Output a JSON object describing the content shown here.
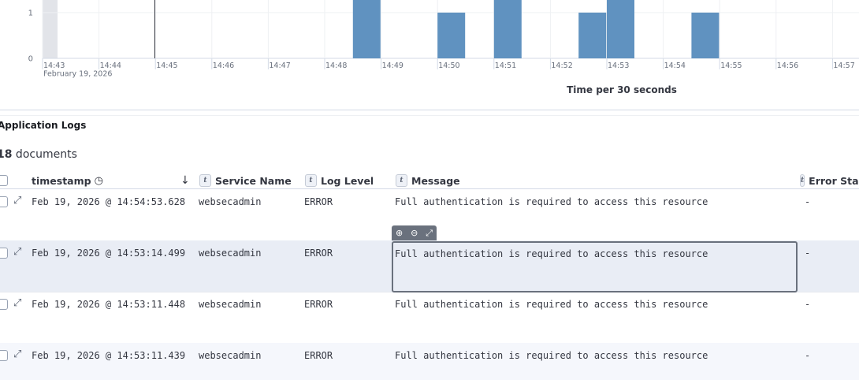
{
  "histogram": {
    "y_ticks": [
      "1",
      "0"
    ],
    "x_ticks": [
      "14:43",
      "14:44",
      "14:45",
      "14:46",
      "14:47",
      "14:48",
      "14:49",
      "14:50",
      "14:51",
      "14:52",
      "14:53",
      "14:54",
      "14:55",
      "14:56",
      "14:57"
    ],
    "date_label": "February 19, 2026",
    "axis_title": "Time per 30 seconds",
    "bar_color": "#6092c0",
    "bars": [
      {
        "start": "14:48:30",
        "count": 2
      },
      {
        "start": "14:50:00",
        "count": 1
      },
      {
        "start": "14:51:00",
        "count": 2
      },
      {
        "start": "14:52:30",
        "count": 1
      },
      {
        "start": "14:53:00",
        "count": 2
      },
      {
        "start": "14:54:30",
        "count": 1
      }
    ]
  },
  "panel": {
    "title": "Application Logs",
    "doc_count": "18",
    "doc_count_suffix": " documents"
  },
  "columns": {
    "timestamp": "timestamp",
    "service": "Service Name",
    "level": "Log Level",
    "message": "Message",
    "error_stack": "Error Stac",
    "type_badge": "t"
  },
  "rows": [
    {
      "timestamp": "Feb 19, 2026 @ 14:54:53.628",
      "service": "websecadmin",
      "level": "ERROR",
      "message": "Full authentication is required to access this resource",
      "error_stack": "-"
    },
    {
      "timestamp": "Feb 19, 2026 @ 14:53:14.499",
      "service": "websecadmin",
      "level": "ERROR",
      "message": "Full authentication is required to access this resource",
      "error_stack": "-"
    },
    {
      "timestamp": "Feb 19, 2026 @ 14:53:11.448",
      "service": "websecadmin",
      "level": "ERROR",
      "message": "Full authentication is required to access this resource",
      "error_stack": "-"
    },
    {
      "timestamp": "Feb 19, 2026 @ 14:53:11.439",
      "service": "websecadmin",
      "level": "ERROR",
      "message": "Full authentication is required to access this resource",
      "error_stack": "-"
    }
  ],
  "icons": {
    "expand": "⤢",
    "zoom_in": "⊕",
    "zoom_out": "⊖",
    "clock": "◷",
    "sort_desc": "↓"
  }
}
